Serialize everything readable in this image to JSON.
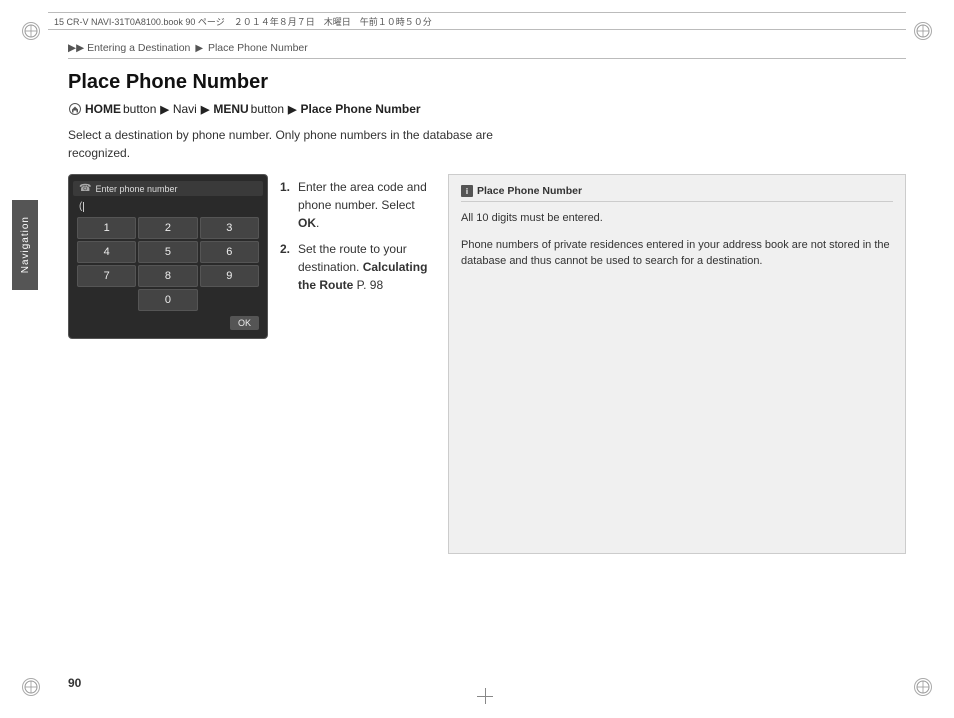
{
  "page": {
    "number": "90",
    "topStrip": "15 CR-V NAVI-31T0A8100.book  90 ページ　２０１４年８月７日　木曜日　午前１０時５０分"
  },
  "breadcrumb": {
    "items": [
      "Entering a Destination",
      "Place Phone Number"
    ],
    "separator": "▶"
  },
  "title": "Place Phone Number",
  "sidebar": {
    "label": "Navigation"
  },
  "homeButtonLine": {
    "icon": "home",
    "parts": [
      {
        "text": "HOME",
        "bold": true
      },
      {
        "text": " button ",
        "bold": false
      },
      {
        "text": "▶",
        "bold": false
      },
      {
        "text": " Navi ",
        "bold": false
      },
      {
        "text": "▶",
        "bold": false
      },
      {
        "text": " MENU",
        "bold": true
      },
      {
        "text": " button ",
        "bold": false
      },
      {
        "text": "▶",
        "bold": false
      },
      {
        "text": " Place Phone Number",
        "bold": true
      }
    ]
  },
  "bodyText": "Select a destination by phone number. Only phone numbers in the database are recognized.",
  "phoneUI": {
    "title": "Enter phone number",
    "cursorChar": "(",
    "keys": [
      "1",
      "2",
      "3",
      "4",
      "5",
      "6",
      "7",
      "8",
      "9",
      "0"
    ],
    "okLabel": "OK"
  },
  "steps": [
    {
      "number": "1.",
      "text": "Enter the area code and phone number. Select ",
      "bold": "OK",
      "textAfter": "."
    },
    {
      "number": "2.",
      "text": "Set the route to your destination. ",
      "bold": "Calculating the Route",
      "textAfter": " P. 98"
    }
  ],
  "rightPanel": {
    "title": "Place Phone Number",
    "paragraphs": [
      "All 10 digits must be entered.",
      "Phone numbers of private residences entered in your address book are not stored in the database and thus cannot be used to search for a destination."
    ]
  }
}
